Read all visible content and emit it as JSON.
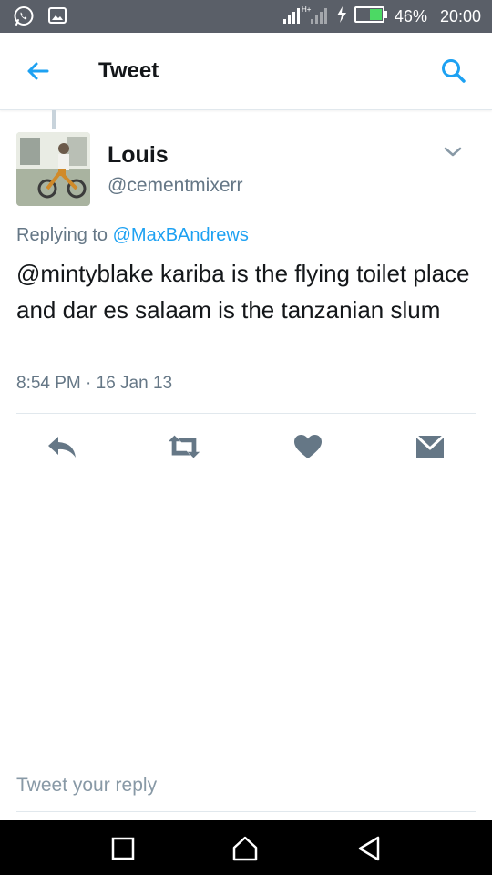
{
  "status_bar": {
    "network": "H+",
    "battery_percent": "46%",
    "time": "20:00",
    "icons": [
      "whatsapp-icon",
      "gallery-icon",
      "signal-icon",
      "charging-icon",
      "battery-icon"
    ]
  },
  "app_bar": {
    "title": "Tweet",
    "icons": [
      "back-arrow-icon",
      "search-icon"
    ]
  },
  "tweet": {
    "author_name": "Louis",
    "author_handle": "@cementmixerr",
    "replying_prefix": "Replying to",
    "replying_handle": "@MaxBAndrews",
    "text": "@mintyblake kariba is the flying toilet place and dar es salaam is the tanzanian slum",
    "timestamp": "8:54 PM · 16 Jan 13"
  },
  "actions": [
    "reply-icon",
    "retweet-icon",
    "like-icon",
    "direct-message-icon"
  ],
  "reply_box": {
    "placeholder": "Tweet your reply"
  },
  "colors": {
    "accent": "#1da1f2",
    "status_bar": "#5a5f68",
    "text_primary": "#14171a",
    "text_secondary": "#657786",
    "icon_gray": "#8899a6",
    "battery_green": "#4cd964"
  }
}
